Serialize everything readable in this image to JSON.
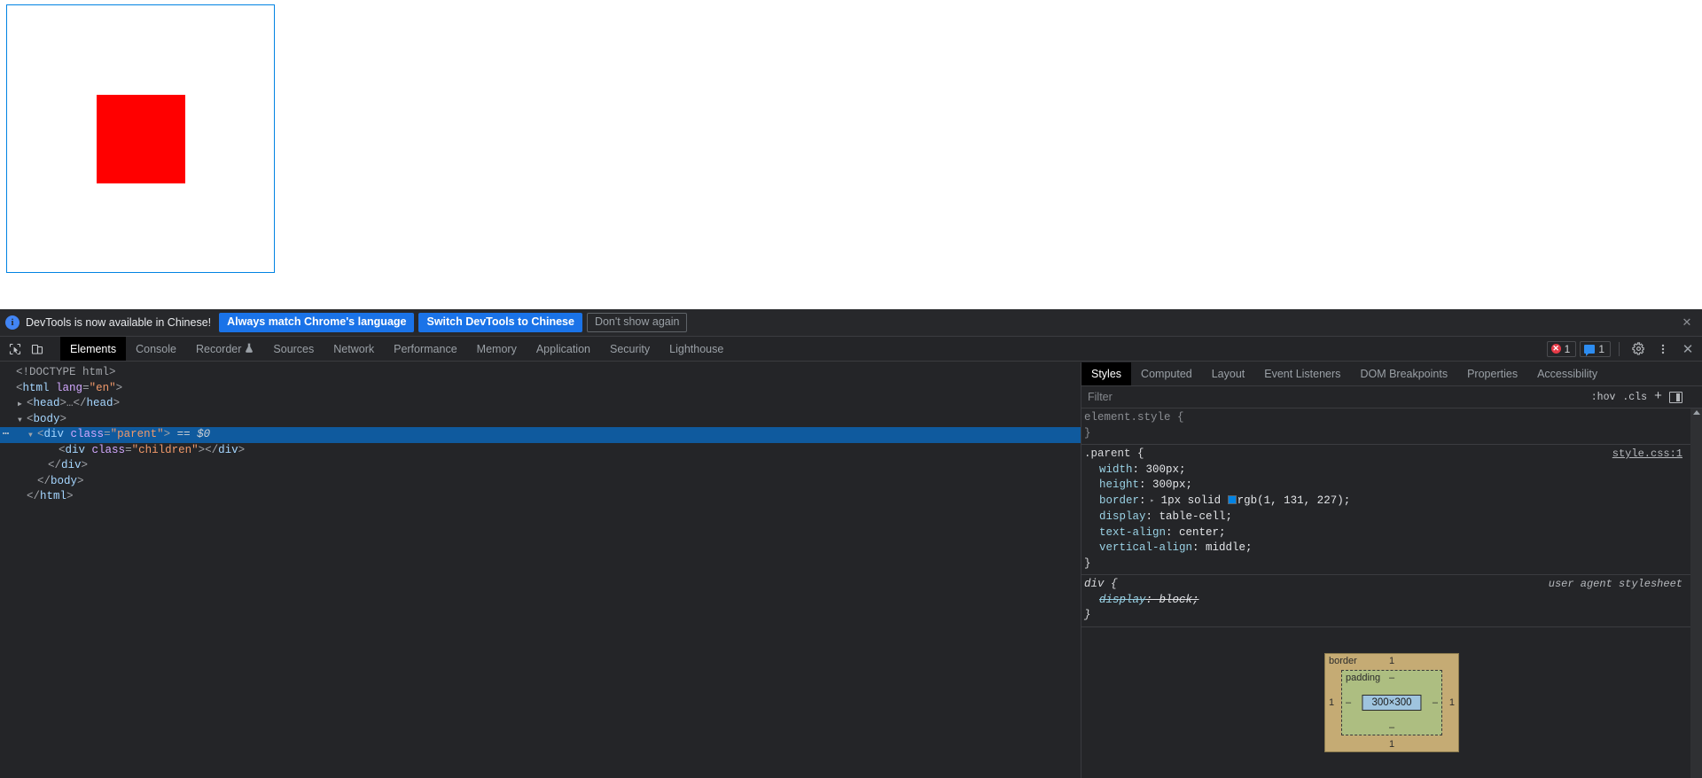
{
  "page": {
    "parent_box": {
      "name": "parent-div",
      "border_color": "#0183e3"
    },
    "child_box": {
      "name": "children-div",
      "color": "#ff0000"
    }
  },
  "infobar": {
    "icon": "info-icon",
    "icon_glyph": "i",
    "message": "DevTools is now available in Chinese!",
    "primary_button": "Always match Chrome's language",
    "secondary_button": "Switch DevTools to Chinese",
    "dismiss_button": "Don't show again",
    "close_glyph": "✕"
  },
  "tabbar": {
    "inspect_icon": "inspect-element-icon",
    "device_icon": "device-toolbar-icon",
    "tabs": [
      {
        "label": "Elements",
        "active": true,
        "icon": ""
      },
      {
        "label": "Console",
        "active": false,
        "icon": ""
      },
      {
        "label": "Recorder",
        "active": false,
        "icon": "flask-icon"
      },
      {
        "label": "Sources",
        "active": false,
        "icon": ""
      },
      {
        "label": "Network",
        "active": false,
        "icon": ""
      },
      {
        "label": "Performance",
        "active": false,
        "icon": ""
      },
      {
        "label": "Memory",
        "active": false,
        "icon": ""
      },
      {
        "label": "Application",
        "active": false,
        "icon": ""
      },
      {
        "label": "Security",
        "active": false,
        "icon": ""
      },
      {
        "label": "Lighthouse",
        "active": false,
        "icon": ""
      }
    ],
    "error_badge": {
      "count": "1",
      "icon": "error-icon",
      "glyph": "✕"
    },
    "message_badge": {
      "count": "1",
      "icon": "message-icon"
    },
    "settings_icon": "gear-icon",
    "more_icon": "kebab-menu-icon",
    "close_icon": "close-icon",
    "close_glyph": "✕"
  },
  "dom": {
    "lines": [
      {
        "indent": 0,
        "toggle": "",
        "selected": false,
        "parts": [
          {
            "t": "punct",
            "s": "<!DOCTYPE html>"
          }
        ]
      },
      {
        "indent": 0,
        "toggle": "",
        "selected": false,
        "parts": [
          {
            "t": "punct",
            "s": "<"
          },
          {
            "t": "tag",
            "s": "html"
          },
          {
            "t": "space",
            "s": " "
          },
          {
            "t": "attr-name",
            "s": "lang"
          },
          {
            "t": "punct",
            "s": "="
          },
          {
            "t": "attr-val",
            "s": "\"en\""
          },
          {
            "t": "punct",
            "s": ">"
          }
        ]
      },
      {
        "indent": 1,
        "toggle": "▶",
        "selected": false,
        "parts": [
          {
            "t": "punct",
            "s": "<"
          },
          {
            "t": "tag",
            "s": "head"
          },
          {
            "t": "punct",
            "s": ">…</"
          },
          {
            "t": "tag",
            "s": "head"
          },
          {
            "t": "punct",
            "s": ">"
          }
        ]
      },
      {
        "indent": 1,
        "toggle": "▼",
        "selected": false,
        "parts": [
          {
            "t": "punct",
            "s": "<"
          },
          {
            "t": "tag",
            "s": "body"
          },
          {
            "t": "punct",
            "s": ">"
          }
        ]
      },
      {
        "indent": 2,
        "toggle": "▼",
        "selected": true,
        "parts": [
          {
            "t": "punct",
            "s": "<"
          },
          {
            "t": "tag",
            "s": "div"
          },
          {
            "t": "space",
            "s": " "
          },
          {
            "t": "attr-name",
            "s": "class"
          },
          {
            "t": "punct",
            "s": "="
          },
          {
            "t": "attr-val",
            "s": "\"parent\""
          },
          {
            "t": "punct",
            "s": ">"
          },
          {
            "t": "space",
            "s": " "
          },
          {
            "t": "dollar",
            "s": "== $0"
          }
        ]
      },
      {
        "indent": 4,
        "toggle": "",
        "selected": false,
        "parts": [
          {
            "t": "punct",
            "s": "<"
          },
          {
            "t": "tag",
            "s": "div"
          },
          {
            "t": "space",
            "s": " "
          },
          {
            "t": "attr-name",
            "s": "class"
          },
          {
            "t": "punct",
            "s": "="
          },
          {
            "t": "attr-val",
            "s": "\"children\""
          },
          {
            "t": "punct",
            "s": "></"
          },
          {
            "t": "tag",
            "s": "div"
          },
          {
            "t": "punct",
            "s": ">"
          }
        ]
      },
      {
        "indent": 3,
        "toggle": "",
        "selected": false,
        "parts": [
          {
            "t": "punct",
            "s": "</"
          },
          {
            "t": "tag",
            "s": "div"
          },
          {
            "t": "punct",
            "s": ">"
          }
        ]
      },
      {
        "indent": 2,
        "toggle": "",
        "selected": false,
        "parts": [
          {
            "t": "punct",
            "s": "</"
          },
          {
            "t": "tag",
            "s": "body"
          },
          {
            "t": "punct",
            "s": ">"
          }
        ]
      },
      {
        "indent": 1,
        "toggle": "",
        "selected": false,
        "parts": [
          {
            "t": "punct",
            "s": "</"
          },
          {
            "t": "tag",
            "s": "html"
          },
          {
            "t": "punct",
            "s": ">"
          }
        ]
      }
    ]
  },
  "styles": {
    "tabs": [
      {
        "label": "Styles",
        "active": true
      },
      {
        "label": "Computed",
        "active": false
      },
      {
        "label": "Layout",
        "active": false
      },
      {
        "label": "Event Listeners",
        "active": false
      },
      {
        "label": "DOM Breakpoints",
        "active": false
      },
      {
        "label": "Properties",
        "active": false
      },
      {
        "label": "Accessibility",
        "active": false
      }
    ],
    "filter_placeholder": "Filter",
    "filter_value": "",
    "actions": {
      "hov": ":hov",
      "cls": ".cls",
      "plus": "+",
      "sidebar_toggle": "toggle-sidebar-icon"
    },
    "rules": [
      {
        "selector": "element.style",
        "origin": "",
        "origin_type": "none",
        "ua": false,
        "declarations": []
      },
      {
        "selector": ".parent",
        "origin": "style.css:1",
        "origin_type": "link",
        "ua": false,
        "declarations": [
          {
            "prop": "width",
            "value": "300px",
            "struck": false,
            "swatch": "",
            "expand": false
          },
          {
            "prop": "height",
            "value": "300px",
            "struck": false,
            "swatch": "",
            "expand": false
          },
          {
            "prop": "border",
            "value": "1px solid rgb(1, 131, 227)",
            "struck": false,
            "swatch": "#0183e3",
            "expand": true
          },
          {
            "prop": "display",
            "value": "table-cell",
            "struck": false,
            "swatch": "",
            "expand": false
          },
          {
            "prop": "text-align",
            "value": "center",
            "struck": false,
            "swatch": "",
            "expand": false
          },
          {
            "prop": "vertical-align",
            "value": "middle",
            "struck": false,
            "swatch": "",
            "expand": false
          }
        ]
      },
      {
        "selector": "div",
        "origin": "user agent stylesheet",
        "origin_type": "ua",
        "ua": true,
        "declarations": [
          {
            "prop": "display",
            "value": "block",
            "struck": true,
            "swatch": "",
            "expand": false
          }
        ]
      }
    ],
    "box_model": {
      "border_label": "border",
      "border_top": "1",
      "border_right": "1",
      "border_bottom": "1",
      "border_left": "1",
      "padding_label": "padding",
      "padding_top": "–",
      "padding_right": "–",
      "padding_bottom": "–",
      "padding_left": "–",
      "content": "300×300",
      "colors": {
        "border": "#c5ab74",
        "padding": "#adbe81",
        "content": "#9fc4de"
      }
    }
  }
}
